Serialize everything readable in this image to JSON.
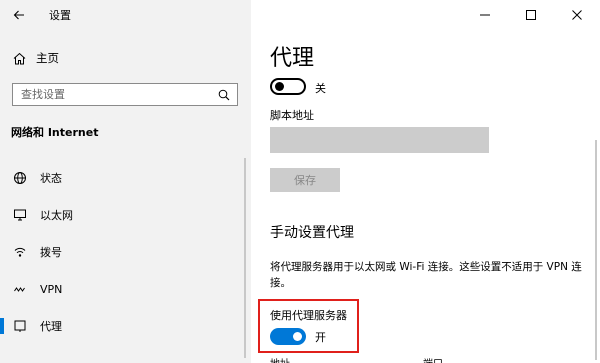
{
  "window": {
    "title": "设置"
  },
  "sidebar": {
    "home_label": "主页",
    "search_placeholder": "查找设置",
    "category": "网络和 Internet",
    "items": [
      {
        "label": "状态",
        "icon": "globe-icon"
      },
      {
        "label": "以太网",
        "icon": "monitor-icon"
      },
      {
        "label": "拨号",
        "icon": "dialup-icon"
      },
      {
        "label": "VPN",
        "icon": "vpn-icon"
      },
      {
        "label": "代理",
        "icon": "proxy-icon",
        "active": true
      }
    ]
  },
  "main": {
    "title": "代理",
    "auto_toggle_state": "关",
    "script_label": "脚本地址",
    "script_value": "",
    "save_label": "保存",
    "manual_title": "手动设置代理",
    "manual_desc": "将代理服务器用于以太网或 Wi-Fi 连接。这些设置不适用于 VPN 连接。",
    "use_proxy_label": "使用代理服务器",
    "use_proxy_state": "开",
    "address_label": "地址",
    "port_label": "端口"
  },
  "colors": {
    "accent": "#0078d7",
    "highlight": "#e0201b"
  }
}
